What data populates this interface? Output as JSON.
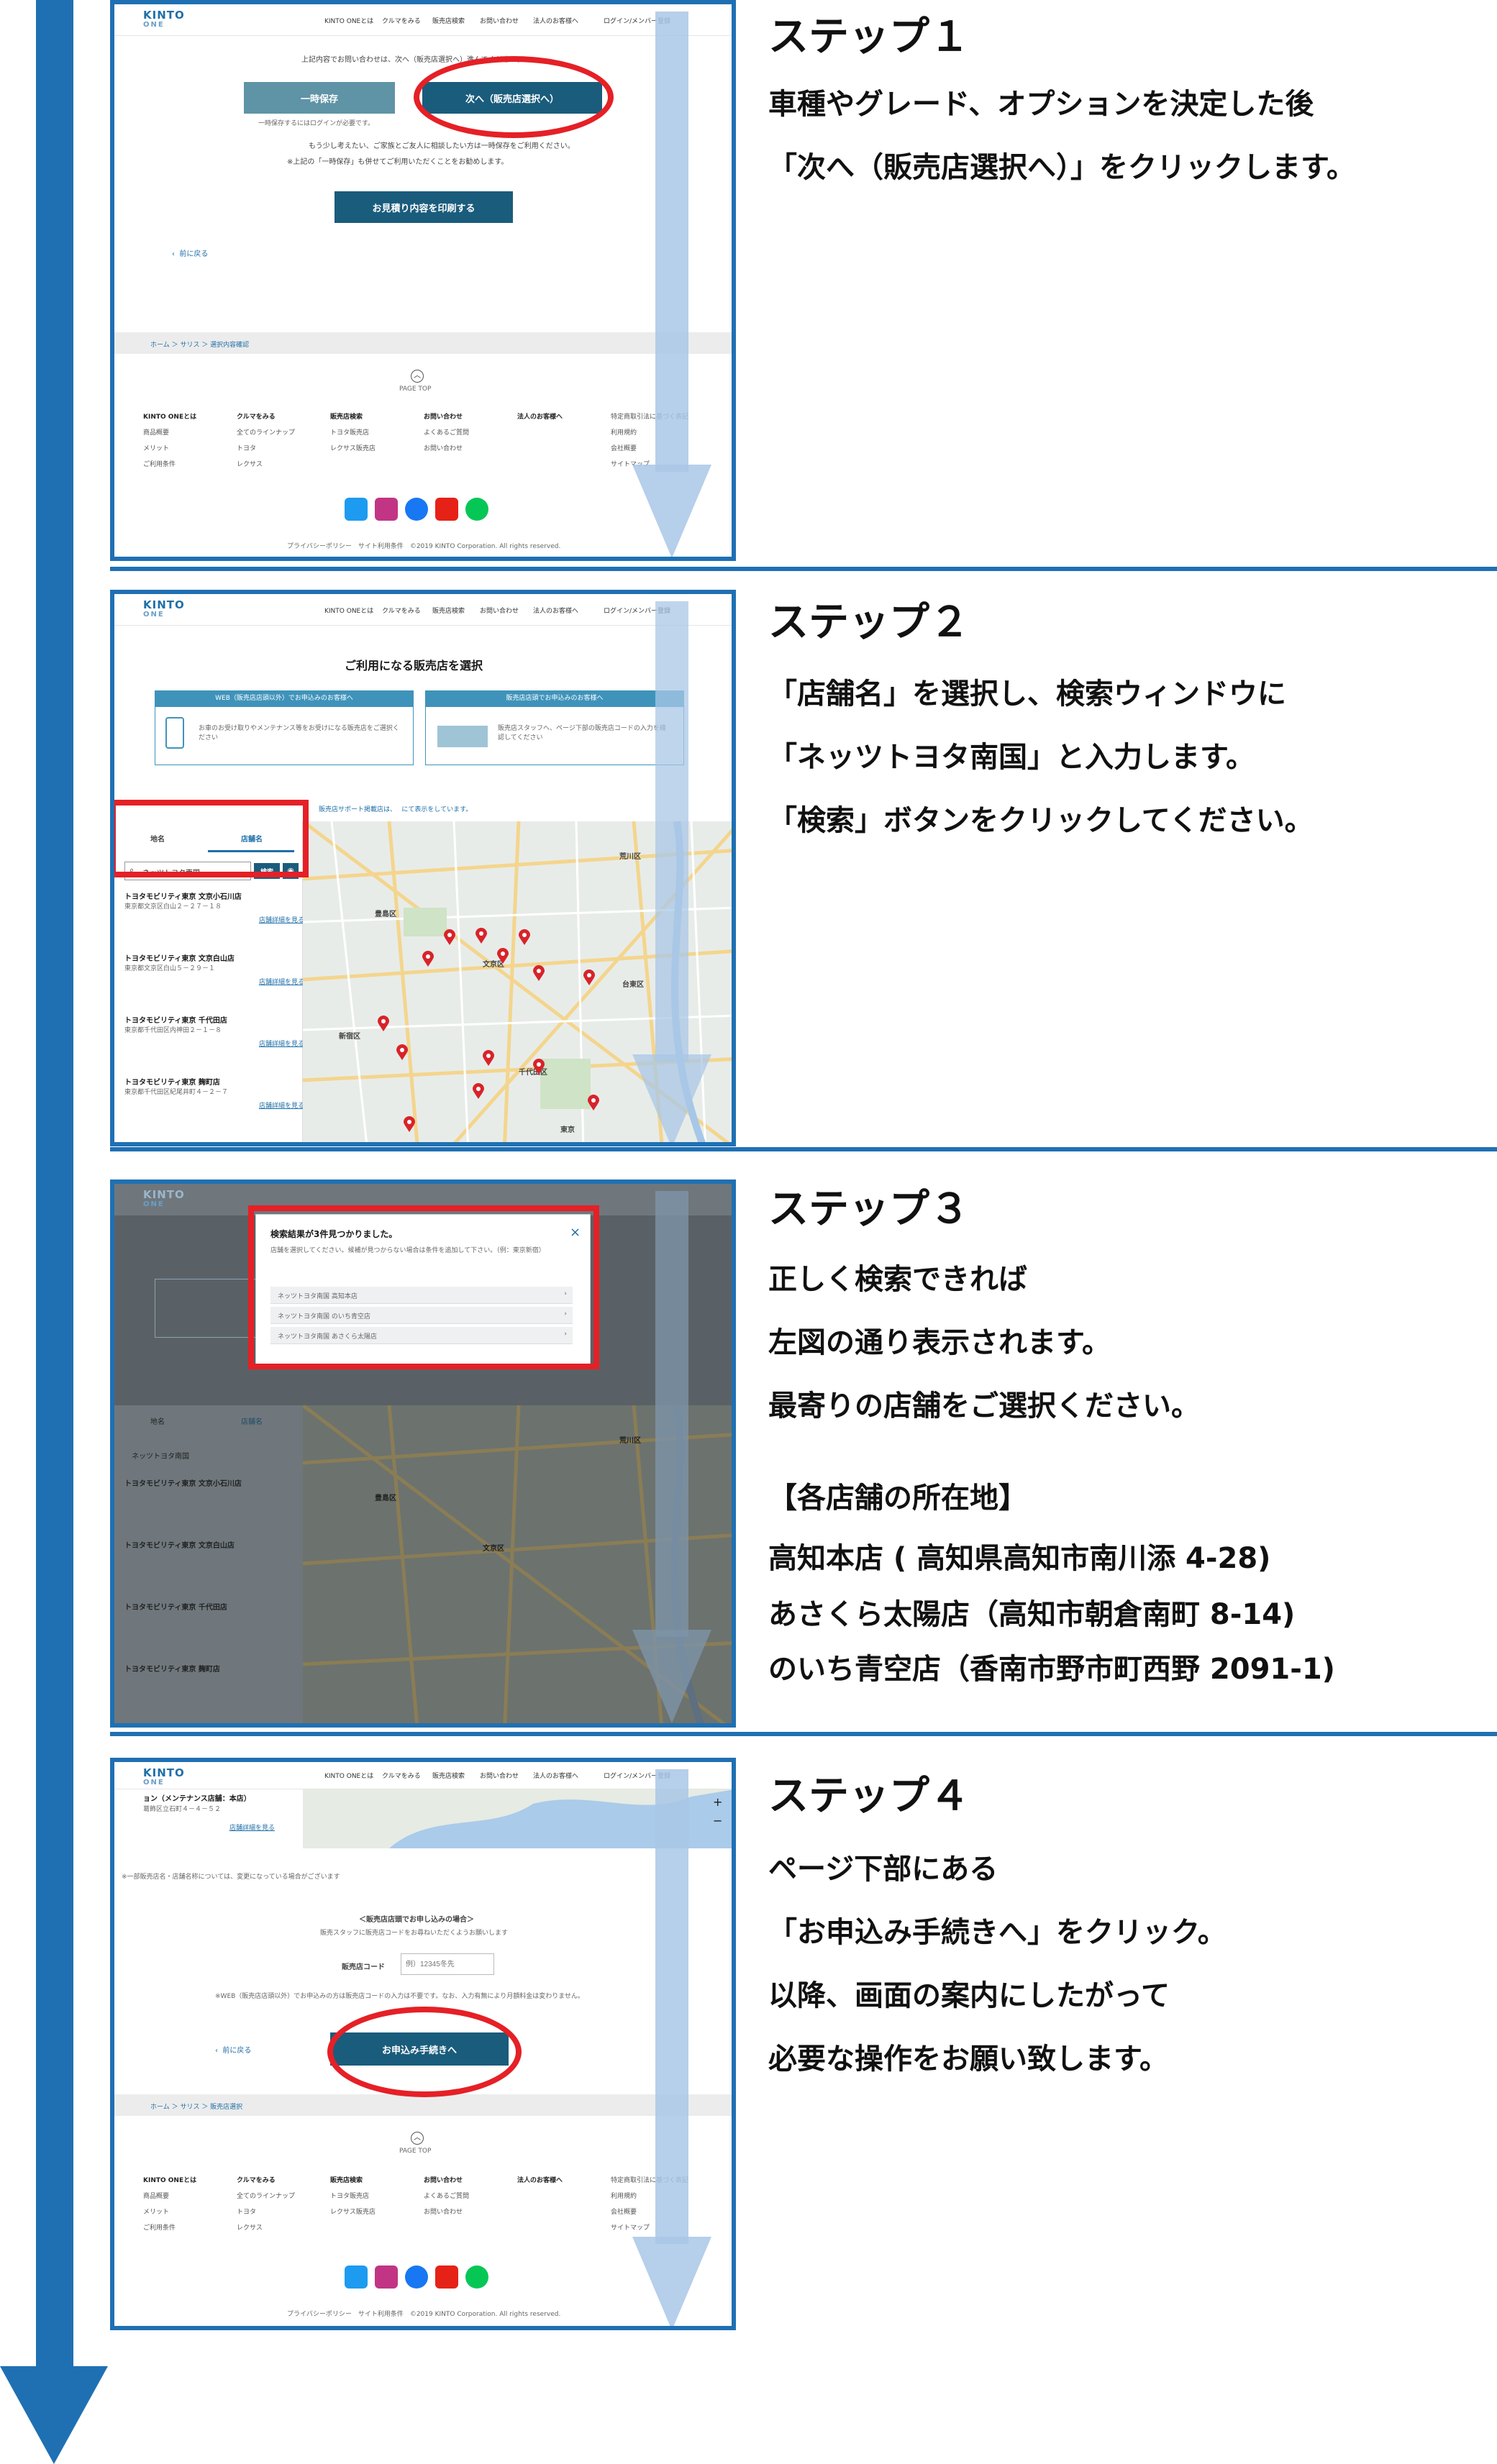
{
  "steps": [
    {
      "title": "ステップ１",
      "lines": [
        "車種やグレード、オプションを決定した後",
        "「次へ（販売店選択へ）」をクリックします。"
      ],
      "screen": {
        "nav": [
          "KINTO ONEとは",
          "クルマをみる",
          "販売店検索",
          "お問い合わせ",
          "法人のお客様へ",
          "ログイン/メンバー登録"
        ],
        "intro": "上記内容でお問い合わせは、次へ（販売店選択へ）進んでください。",
        "save_label": "一時保存",
        "next_label": "次へ（販売店選択へ）",
        "save_note": "一時保存するにはログインが必要です。",
        "note1": "もう少し考えたい、ご家族とご友人に相談したい方は一時保存をご利用ください。",
        "note2": "※上記の「一時保存」も併せてご利用いただくことをお勧めします。",
        "print_label": "お見積り内容を印刷する",
        "back_label": "前に戻る",
        "breadcrumb": "ホーム ＞ サリス ＞ 選択内容確認",
        "page_top": "PAGE TOP",
        "footer_cols": [
          [
            "KINTO ONEとは",
            "商品概要",
            "メリット",
            "ご利用条件"
          ],
          [
            "クルマをみる",
            "全てのラインナップ",
            "トヨタ",
            "レクサス"
          ],
          [
            "販売店検索",
            "トヨタ販売店",
            "レクサス販売店"
          ],
          [
            "お問い合わせ",
            "よくあるご質問",
            "お問い合わせ"
          ],
          [
            "法人のお客様へ"
          ],
          [
            "特定商取引法に基づく表記",
            "利用規約",
            "会社概要",
            "サイトマップ"
          ]
        ],
        "copyright": "プライバシーポリシー　サイト利用条件　©2019 KINTO Corporation. All rights reserved."
      }
    },
    {
      "title": "ステップ２",
      "lines": [
        "「店舗名」を選択し、検索ウィンドウに",
        "「ネッツトヨタ南国」と入力します。",
        "「検索」ボタンをクリックしてください。"
      ],
      "screen": {
        "page_title": "ご利用になる販売店を選択",
        "tab_web": "WEB（販売店店頭以外）でお申込みのお客様へ",
        "tab_store": "販売店店頭でお申込みのお客様へ",
        "web_desc": "お車のお受け取りやメンテナンス等をお受けになる販売店をご選択ください",
        "store_desc": "販売店スタッフへ、ページ下部の販売店コードの入力を確認してください",
        "support_note": "販売店サポート掲載店は、　 にて表示をしています。",
        "tab_area": "地名",
        "tab_name": "店舗名",
        "search_value": "ネッツトヨタ南国",
        "search_button": "検索",
        "results": [
          {
            "name": "トヨタモビリティ東京 文京小石川店",
            "addr": "東京都文京区白山２－２７－１８",
            "link": "店舗詳細を見る"
          },
          {
            "name": "トヨタモビリティ東京 文京白山店",
            "addr": "東京都文京区白山５－２９－１",
            "link": "店舗詳細を見る"
          },
          {
            "name": "トヨタモビリティ東京 千代田店",
            "addr": "東京都千代田区内神田２－１－８",
            "link": "店舗詳細を見る"
          },
          {
            "name": "トヨタモビリティ東京 麹町店",
            "addr": "東京都千代田区紀尾井町４－２－７",
            "link": "店舗詳細を見る"
          }
        ],
        "map_labels": [
          "荒川区",
          "豊島区",
          "文京区",
          "台東区",
          "新宿区",
          "千代田区",
          "東京"
        ]
      }
    },
    {
      "title": "ステップ３",
      "lines": [
        "正しく検索できれば",
        "左図の通り表示されます。",
        "最寄りの店舗をご選択ください。"
      ],
      "locations_heading": "【各店舗の所在地】",
      "locations": [
        "高知本店 ( 高知県高知市南川添 4-28)",
        "あさくら太陽店（高知市朝倉南町 8-14)",
        "のいち青空店（香南市野市町西野 2091-1)"
      ],
      "screen": {
        "modal_title": "検索結果が3件見つかりました。",
        "modal_desc": "店舗を選択してください。候補が見つからない場合は条件を追加して下さい。（例：東京新宿）",
        "modal_items": [
          "ネッツトヨタ南国 高知本店",
          "ネッツトヨタ南国 のいち青空店",
          "ネッツトヨタ南国 あさくら太陽店"
        ],
        "close": "×"
      }
    },
    {
      "title": "ステップ４",
      "lines": [
        "ページ下部にある",
        "「お申込み手続きへ」をクリック。",
        "以降、画面の案内にしたがって",
        "必要な操作をお願い致します。"
      ],
      "screen": {
        "partial_name": "ョン（メンテナンス店舗：本店）",
        "partial_addr": "葛飾区立石町４－４－５２",
        "partial_link": "店舗詳細を見る",
        "notice": "※一部販売店名・店舗名称については、変更になっている場合がございます",
        "store_heading": "＜販売店店頭でお申し込みの場合＞",
        "store_desc": "販売スタッフに販売店コードをお尋ねいただくようお願いします",
        "code_label": "販売店コード",
        "code_placeholder": "例）12345冬先",
        "web_note": "※WEB（販売店店頭以外）でお申込みの方は販売店コードの入力は不要です。なお、入力有無により月額料金は変わりません。",
        "back_label": "前に戻る",
        "apply_label": "お申込み手続きへ",
        "breadcrumb": "ホーム ＞ サリス ＞ 販売店選択"
      }
    }
  ],
  "colors": {
    "accent": "#1f70b3",
    "red": "#e52026",
    "button_teal": "#1a5c7c",
    "button_grey": "#5f93a6"
  }
}
